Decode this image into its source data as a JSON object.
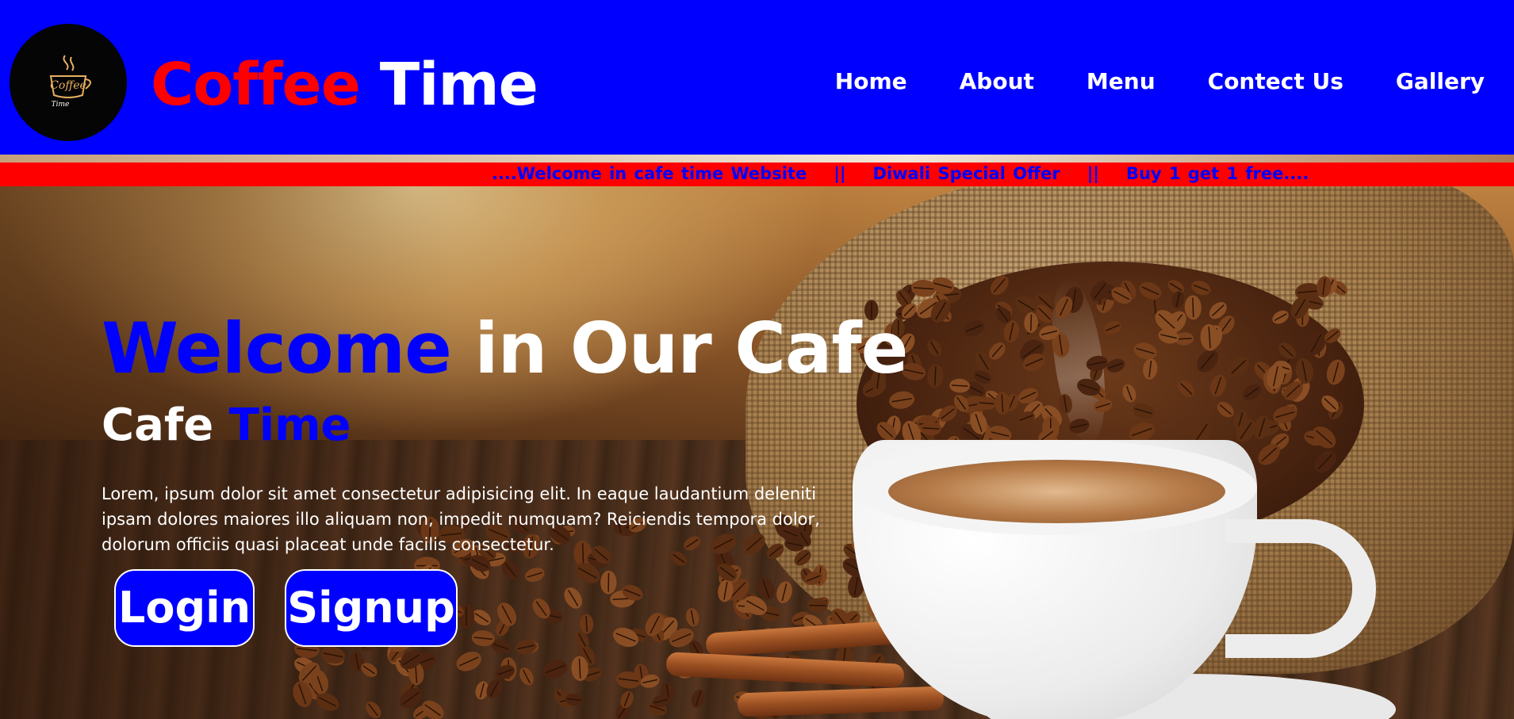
{
  "header": {
    "brand_first": "Coffee",
    "brand_second": "Time",
    "logo_text": "Coffee",
    "logo_subtext": "Time",
    "nav": [
      {
        "label": "Home"
      },
      {
        "label": "About"
      },
      {
        "label": "Menu"
      },
      {
        "label": "Contect Us"
      },
      {
        "label": "Gallery"
      }
    ]
  },
  "marquee": {
    "item1": "....Welcome in cafe time Website",
    "sep1": "||",
    "item2": "Diwali Special Offer",
    "sep2": "||",
    "item3": "Buy 1 get 1 free...."
  },
  "hero": {
    "title_highlight": "Welcome",
    "title_rest": "in Our Cafe",
    "subtitle_first": "Cafe",
    "subtitle_second": "Time",
    "paragraph": "Lorem, ipsum dolor sit amet consectetur adipisicing elit. In eaque laudantium deleniti ipsam dolores maiores illo aliquam non, impedit numquam? Reiciendis tempora dolor, dolorum officiis quasi placeat unde facilis consectetur.",
    "login_label": "Login",
    "signup_label": "Signup"
  },
  "colors": {
    "header_bg": "#0000ff",
    "accent_red": "#ff0000",
    "accent_blue": "#0000ff",
    "text_white": "#ffffff"
  },
  "icons": {
    "logo": "coffee-cup-logo-icon"
  }
}
